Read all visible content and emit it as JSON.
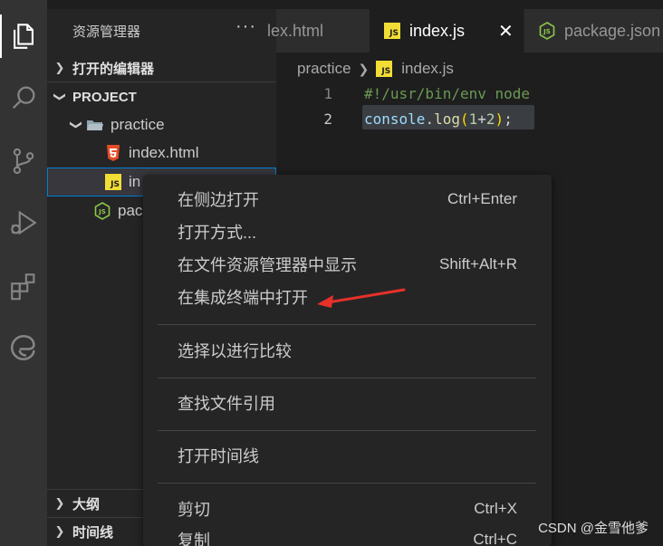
{
  "sidebar": {
    "title": "资源管理器",
    "more": "···",
    "sections": {
      "open_editors": "打开的编辑器",
      "project": "PROJECT",
      "outline": "大纲",
      "timeline": "时间线"
    },
    "tree": {
      "folder": "practice",
      "file_html": "index.html",
      "file_js_partial": "in",
      "file_pkg_partial": "pac"
    }
  },
  "tabs": [
    {
      "label": "lex.html"
    },
    {
      "label": "index.js"
    },
    {
      "label": "package.json"
    }
  ],
  "tab_close": "✕",
  "breadcrumb": {
    "folder": "practice",
    "file": "index.js"
  },
  "editor": {
    "lines": [
      {
        "num": "1",
        "text": "#!/usr/bin/env node"
      },
      {
        "num": "2",
        "parts": [
          "console",
          ".",
          "log",
          "(",
          "1",
          "+",
          "2",
          ")",
          ";"
        ]
      }
    ]
  },
  "context_menu": {
    "items": [
      {
        "label": "在侧边打开",
        "key": "Ctrl+Enter"
      },
      {
        "label": "打开方式...",
        "key": ""
      },
      {
        "label": "在文件资源管理器中显示",
        "key": "Shift+Alt+R"
      },
      {
        "label": "在集成终端中打开",
        "key": ""
      },
      {
        "label": "选择以进行比较",
        "key": ""
      },
      {
        "label": "查找文件引用",
        "key": ""
      },
      {
        "label": "打开时间线",
        "key": ""
      },
      {
        "label": "剪切",
        "key": "Ctrl+X"
      },
      {
        "label": "复制",
        "key": "Ctrl+C"
      }
    ]
  },
  "watermark": "CSDN @金雪他爹",
  "colors": {
    "accent": "#007fd4",
    "js_badge": "#f1dd35",
    "html_icon": "#e44d26",
    "node_icon": "#8cc84b",
    "arrow": "#e8302a"
  },
  "icons": {
    "activity": [
      "files-icon",
      "search-icon",
      "source-control-icon",
      "run-debug-icon",
      "extensions-icon",
      "edge-icon"
    ]
  }
}
